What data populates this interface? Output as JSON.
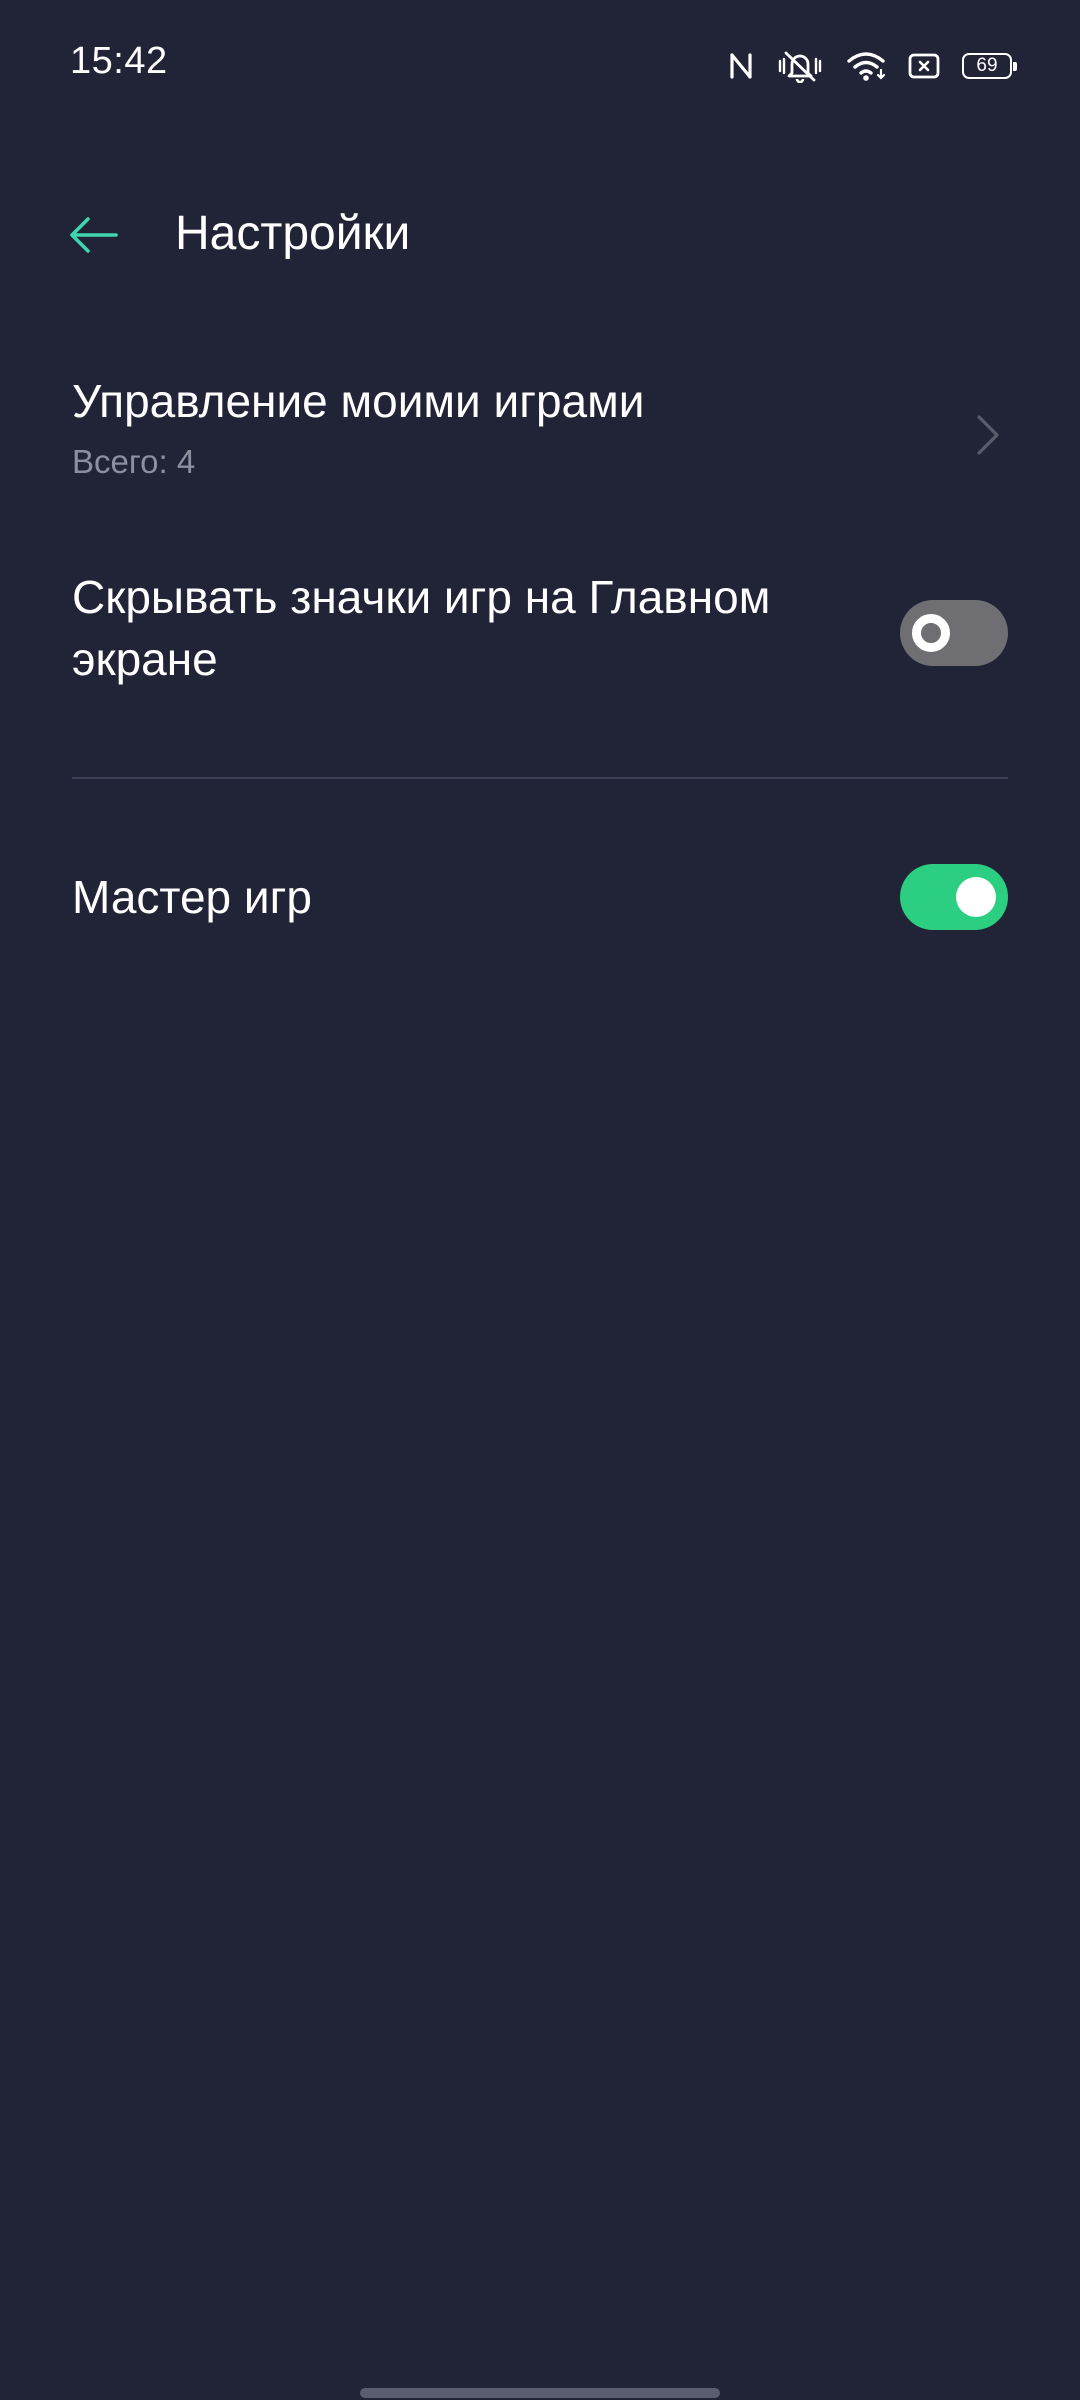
{
  "status_bar": {
    "time": "15:42",
    "battery_level": "69",
    "icons": [
      "nfc-icon",
      "vibrate-mute-icon",
      "wifi-icon",
      "screen-record-icon",
      "battery-icon"
    ]
  },
  "header": {
    "title": "Настройки",
    "back_icon": "arrow-left-icon"
  },
  "settings": {
    "manage_games": {
      "title": "Управление моими играми",
      "subtitle": "Всего: 4"
    },
    "hide_icons": {
      "title": "Скрывать значки игр на Главном экране",
      "enabled": false
    },
    "game_master": {
      "title": "Мастер игр",
      "enabled": true
    }
  },
  "colors": {
    "background": "#212337",
    "accent": "#2ccf81",
    "back_arrow": "#3fd6b0",
    "toggle_off": "#6f6f73",
    "subtitle": "#8d8f9e"
  }
}
